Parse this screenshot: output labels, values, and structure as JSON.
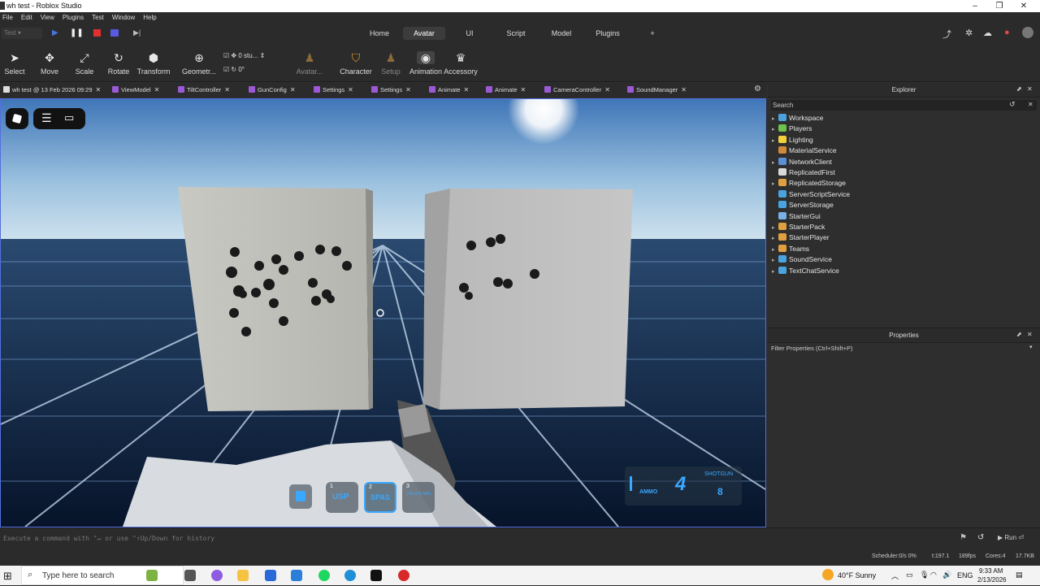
{
  "window": {
    "title": "wh test - Roblox Studio"
  },
  "menu": [
    "File",
    "Edit",
    "View",
    "Plugins",
    "Test",
    "Window",
    "Help"
  ],
  "top_tabs": [
    "Home",
    "Avatar",
    "UI",
    "Script",
    "Model",
    "Plugins"
  ],
  "active_tab": "Avatar",
  "test_mode_label": "Test",
  "add_tab_label": "+",
  "ribbon": {
    "select": "Select",
    "move": "Move",
    "scale": "Scale",
    "rotate": "Rotate",
    "transform": "Transform",
    "geometry": "Geometr...",
    "move_snap": "0 stu...",
    "rotate_snap": "0°",
    "avatar": "Avatar...",
    "setup": "Setup",
    "character": "Character",
    "animation": "Animation",
    "accessory": "Accessory"
  },
  "script_tabs": [
    "wh test @ 13 Feb 2026 09:29",
    "ViewModel",
    "TiltController",
    "GunConfig",
    "Settings",
    "Settings",
    "Animate",
    "Animate",
    "CameraController",
    "SoundManager"
  ],
  "explorer": {
    "title": "Explorer",
    "search_placeholder": "Search",
    "items": [
      {
        "label": "Workspace",
        "icon": "globe-icon",
        "color": "#4aa3df",
        "arrow": true
      },
      {
        "label": "Players",
        "icon": "players-icon",
        "color": "#6cc24a",
        "arrow": true
      },
      {
        "label": "Lighting",
        "icon": "lightbulb-icon",
        "color": "#f2d03b",
        "arrow": true
      },
      {
        "label": "MaterialService",
        "icon": "material-icon",
        "color": "#d0883a",
        "arrow": false
      },
      {
        "label": "NetworkClient",
        "icon": "network-icon",
        "color": "#5b8fd6",
        "arrow": true
      },
      {
        "label": "ReplicatedFirst",
        "icon": "replicated-icon",
        "color": "#d9d9d9",
        "arrow": false
      },
      {
        "label": "ReplicatedStorage",
        "icon": "storage-icon",
        "color": "#e0a040",
        "arrow": true
      },
      {
        "label": "ServerScriptService",
        "icon": "script-service-icon",
        "color": "#4aa3df",
        "arrow": false
      },
      {
        "label": "ServerStorage",
        "icon": "server-storage-icon",
        "color": "#4aa3df",
        "arrow": false
      },
      {
        "label": "StarterGui",
        "icon": "gui-icon",
        "color": "#7ab0e8",
        "arrow": false
      },
      {
        "label": "StarterPack",
        "icon": "pack-icon",
        "color": "#e0a040",
        "arrow": true
      },
      {
        "label": "StarterPlayer",
        "icon": "player-icon",
        "color": "#e0a040",
        "arrow": true
      },
      {
        "label": "Teams",
        "icon": "teams-icon",
        "color": "#e0a040",
        "arrow": true
      },
      {
        "label": "SoundService",
        "icon": "sound-icon",
        "color": "#4aa3df",
        "arrow": true
      },
      {
        "label": "TextChatService",
        "icon": "chat-icon",
        "color": "#4aa3df",
        "arrow": true
      }
    ]
  },
  "properties": {
    "title": "Properties",
    "filter_placeholder": "Filter Properties (Ctrl+Shift+P)"
  },
  "game_hud": {
    "slots": [
      {
        "num": "1",
        "label": "USP"
      },
      {
        "num": "2",
        "label": "SPAS"
      },
      {
        "num": "3",
        "label": "HELIOS MK1"
      }
    ],
    "ammo_label": "AMMO",
    "ammo_count": "4",
    "reserve_count": "8",
    "weapon_name": "SHOTGUN"
  },
  "command_bar": {
    "placeholder": "Execute a command with \"↵ or use \"↑Up/Down for history",
    "run_label": "Run"
  },
  "status_bar": {
    "scheduler": "Scheduler:0/s 0%",
    "t": "t:197.1",
    "fps": "189fps",
    "cores": "Cores:4",
    "mem": "17.7KB"
  },
  "taskbar": {
    "search_placeholder": "Type here to search",
    "weather": "40°F Sunny",
    "language": "ENG",
    "time": "9:33 AM",
    "date": "2/13/2026"
  }
}
